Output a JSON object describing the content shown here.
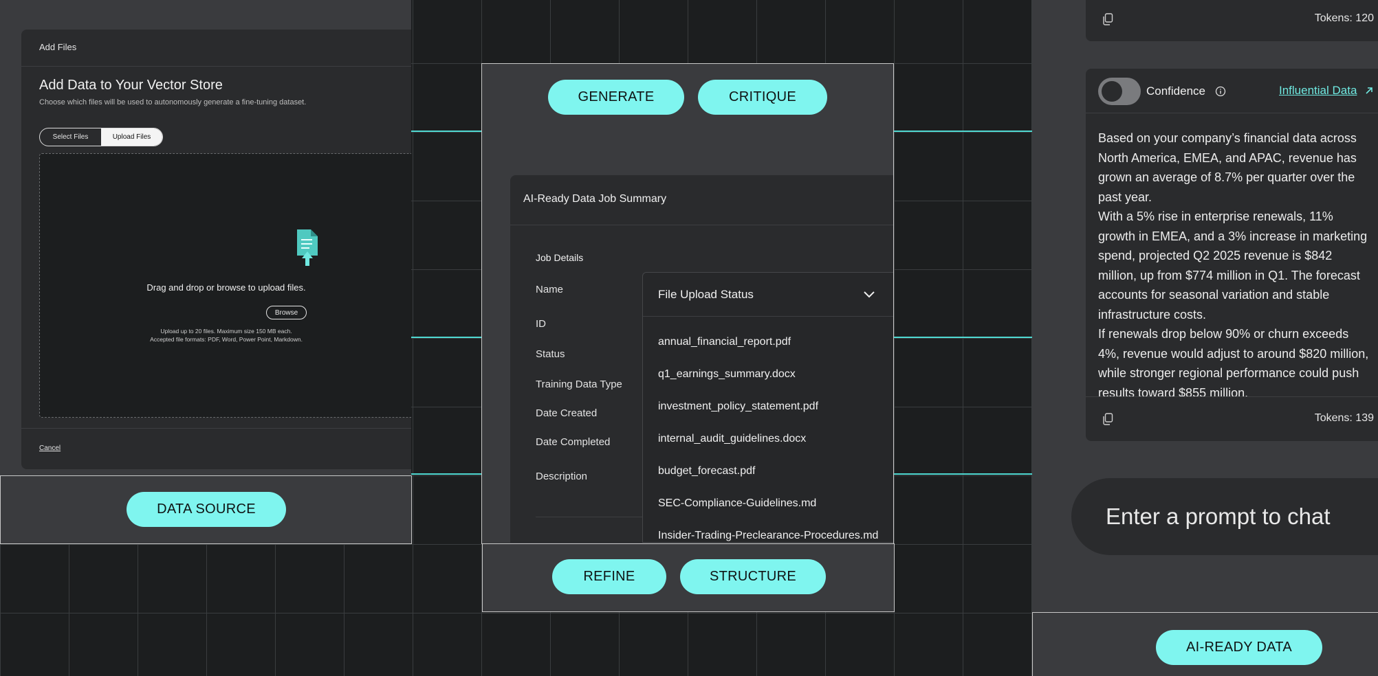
{
  "data_source": {
    "dialog_header": "Add Files",
    "title": "Add Data to Your Vector Store",
    "subtitle": "Choose which files will be used to autonomously generate a fine-tuning dataset.",
    "tabs": [
      "Select Files",
      "Upload Files"
    ],
    "drop_text": "Drag and drop or browse to upload files.",
    "browse_label": "Browse",
    "limits_line1": "Upload up to 20 files. Maximum size 150 MB each.",
    "limits_line2": "Accepted file formats: PDF, Word, Power Point, Markdown.",
    "cancel_label": "Cancel",
    "stage_label": "DATA SOURCE"
  },
  "pipeline": {
    "generate": "GENERATE",
    "critique": "CRITIQUE",
    "refine": "REFINE",
    "structure": "STRUCTURE",
    "ai_ready": "AI-READY DATA"
  },
  "job_summary": {
    "title": "AI-Ready Data Job Summary",
    "section": "Job Details",
    "labels": [
      "Name",
      "ID",
      "Status",
      "Training Data Type",
      "Date Created",
      "Date Completed",
      "Description"
    ]
  },
  "file_status": {
    "title": "File Upload Status",
    "files": [
      "annual_financial_report.pdf",
      "q1_earnings_summary.docx",
      "investment_policy_statement.pdf",
      "internal_audit_guidelines.docx",
      "budget_forecast.pdf",
      "SEC-Compliance-Guidelines.md",
      "Insider-Trading-Preclearance-Procedures.md"
    ]
  },
  "chat": {
    "tokens_top": "Tokens: 120",
    "confidence_label": "Confidence",
    "influential_link": "Influential Data",
    "response_p1": "Based on your company’s financial data across North America, EMEA, and APAC, revenue has grown an average of 8.7% per quarter over the past year.",
    "response_p2": "With a 5% rise in enterprise renewals, 11% growth in EMEA, and a 3% increase in marketing spend, projected Q2 2025 revenue is $842 million, up from $774 million in Q1. The forecast accounts for seasonal variation and stable infrastructure costs.",
    "response_p3": "If renewals drop below 90% or churn exceeds 4%, revenue would adjust to around $820 million, while stronger regional performance could push results toward $855 million.",
    "tokens_bottom": "Tokens: 139",
    "prompt_placeholder": "Enter a prompt to chat"
  },
  "colors": {
    "accent": "#7ff5ef",
    "connector": "#4fd9d2",
    "panel": "#3a3b3e",
    "card": "#2a2b2d"
  }
}
